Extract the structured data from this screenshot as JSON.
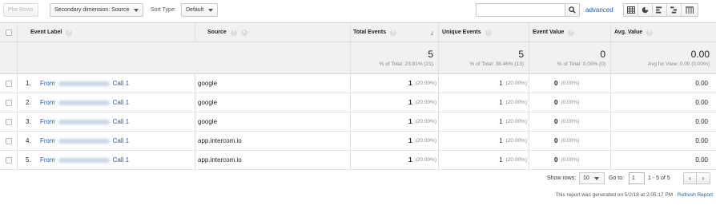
{
  "toolbar": {
    "plot_rows": "Plot Rows",
    "secondary_dimension": "Secondary dimension: Source",
    "sort_type_label": "Sort Type:",
    "sort_type_value": "Default",
    "search_value": "",
    "advanced": "advanced",
    "views": [
      "table-view-icon",
      "pie-view-icon",
      "performance-view-icon",
      "comparison-view-icon",
      "pivot-view-icon"
    ]
  },
  "table": {
    "headers": {
      "event_label": "Event Label",
      "source": "Source",
      "total_events": "Total Events",
      "unique_events": "Unique Events",
      "event_value": "Event Value",
      "avg_value": "Avg. Value"
    },
    "totals": {
      "total_events": "5",
      "total_events_sub": "% of Total: 23.81% (21)",
      "unique_events": "5",
      "unique_events_sub": "% of Total: 38.46% (13)",
      "event_value": "0",
      "event_value_sub": "% of Total: 0.00% (0)",
      "avg_value": "0.00",
      "avg_value_sub": "Avg for View: 0.00 (0.00%)"
    },
    "rows": [
      {
        "idx": "1.",
        "label_prefix": "From",
        "label_suffix": "Call 1",
        "source": "google",
        "total": "1",
        "total_pct": "(20.00%)",
        "unique": "1",
        "unique_pct": "(20.00%)",
        "value": "0",
        "value_pct": "(0.00%)",
        "avg": "0.00"
      },
      {
        "idx": "2.",
        "label_prefix": "From",
        "label_suffix": "Call 1",
        "source": "google",
        "total": "1",
        "total_pct": "(20.00%)",
        "unique": "1",
        "unique_pct": "(20.00%)",
        "value": "0",
        "value_pct": "(0.00%)",
        "avg": "0.00"
      },
      {
        "idx": "3.",
        "label_prefix": "From",
        "label_suffix": "Call 1",
        "source": "google",
        "total": "1",
        "total_pct": "(20.00%)",
        "unique": "1",
        "unique_pct": "(20.00%)",
        "value": "0",
        "value_pct": "(0.00%)",
        "avg": "0.00"
      },
      {
        "idx": "4.",
        "label_prefix": "From",
        "label_suffix": "Call 1",
        "source": "app.intercom.io",
        "total": "1",
        "total_pct": "(20.00%)",
        "unique": "1",
        "unique_pct": "(20.00%)",
        "value": "0",
        "value_pct": "(0.00%)",
        "avg": "0.00"
      },
      {
        "idx": "5.",
        "label_prefix": "From",
        "label_suffix": "Call 1",
        "source": "app.intercom.io",
        "total": "1",
        "total_pct": "(20.00%)",
        "unique": "1",
        "unique_pct": "(20.00%)",
        "value": "0",
        "value_pct": "(0.00%)",
        "avg": "0.00"
      }
    ]
  },
  "footer": {
    "show_rows_label": "Show rows:",
    "show_rows_value": "10",
    "goto_label": "Go to:",
    "goto_value": "1",
    "range": "1 - 5 of 5",
    "generated": "This report was generated on 5/2/18 at 2:05:17 PM · ",
    "refresh": "Refresh Report"
  },
  "colors": {
    "link": "#1a5fb4",
    "header_bg": "#f1f1f1"
  }
}
